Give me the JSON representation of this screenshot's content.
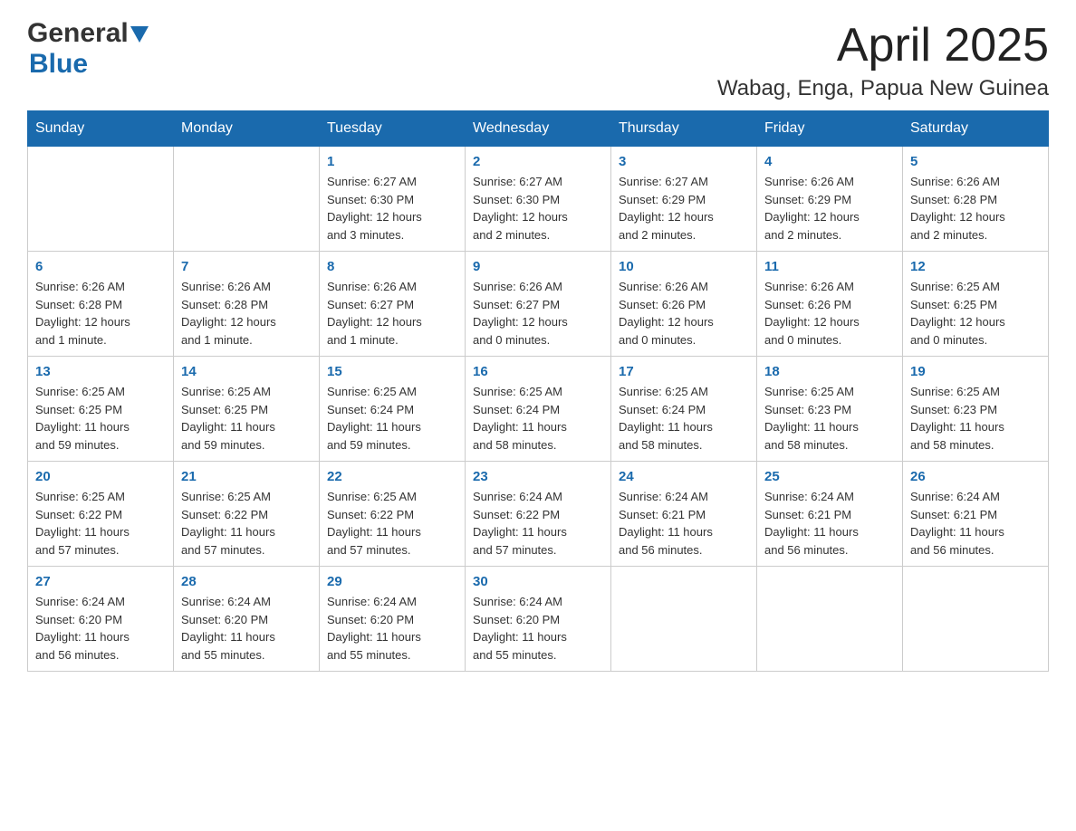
{
  "header": {
    "logo": {
      "general": "General",
      "blue": "Blue",
      "triangle": "▶"
    },
    "title": "April 2025",
    "subtitle": "Wabag, Enga, Papua New Guinea"
  },
  "calendar": {
    "days_of_week": [
      "Sunday",
      "Monday",
      "Tuesday",
      "Wednesday",
      "Thursday",
      "Friday",
      "Saturday"
    ],
    "weeks": [
      [
        {
          "day": "",
          "info": ""
        },
        {
          "day": "",
          "info": ""
        },
        {
          "day": "1",
          "info": "Sunrise: 6:27 AM\nSunset: 6:30 PM\nDaylight: 12 hours\nand 3 minutes."
        },
        {
          "day": "2",
          "info": "Sunrise: 6:27 AM\nSunset: 6:30 PM\nDaylight: 12 hours\nand 2 minutes."
        },
        {
          "day": "3",
          "info": "Sunrise: 6:27 AM\nSunset: 6:29 PM\nDaylight: 12 hours\nand 2 minutes."
        },
        {
          "day": "4",
          "info": "Sunrise: 6:26 AM\nSunset: 6:29 PM\nDaylight: 12 hours\nand 2 minutes."
        },
        {
          "day": "5",
          "info": "Sunrise: 6:26 AM\nSunset: 6:28 PM\nDaylight: 12 hours\nand 2 minutes."
        }
      ],
      [
        {
          "day": "6",
          "info": "Sunrise: 6:26 AM\nSunset: 6:28 PM\nDaylight: 12 hours\nand 1 minute."
        },
        {
          "day": "7",
          "info": "Sunrise: 6:26 AM\nSunset: 6:28 PM\nDaylight: 12 hours\nand 1 minute."
        },
        {
          "day": "8",
          "info": "Sunrise: 6:26 AM\nSunset: 6:27 PM\nDaylight: 12 hours\nand 1 minute."
        },
        {
          "day": "9",
          "info": "Sunrise: 6:26 AM\nSunset: 6:27 PM\nDaylight: 12 hours\nand 0 minutes."
        },
        {
          "day": "10",
          "info": "Sunrise: 6:26 AM\nSunset: 6:26 PM\nDaylight: 12 hours\nand 0 minutes."
        },
        {
          "day": "11",
          "info": "Sunrise: 6:26 AM\nSunset: 6:26 PM\nDaylight: 12 hours\nand 0 minutes."
        },
        {
          "day": "12",
          "info": "Sunrise: 6:25 AM\nSunset: 6:25 PM\nDaylight: 12 hours\nand 0 minutes."
        }
      ],
      [
        {
          "day": "13",
          "info": "Sunrise: 6:25 AM\nSunset: 6:25 PM\nDaylight: 11 hours\nand 59 minutes."
        },
        {
          "day": "14",
          "info": "Sunrise: 6:25 AM\nSunset: 6:25 PM\nDaylight: 11 hours\nand 59 minutes."
        },
        {
          "day": "15",
          "info": "Sunrise: 6:25 AM\nSunset: 6:24 PM\nDaylight: 11 hours\nand 59 minutes."
        },
        {
          "day": "16",
          "info": "Sunrise: 6:25 AM\nSunset: 6:24 PM\nDaylight: 11 hours\nand 58 minutes."
        },
        {
          "day": "17",
          "info": "Sunrise: 6:25 AM\nSunset: 6:24 PM\nDaylight: 11 hours\nand 58 minutes."
        },
        {
          "day": "18",
          "info": "Sunrise: 6:25 AM\nSunset: 6:23 PM\nDaylight: 11 hours\nand 58 minutes."
        },
        {
          "day": "19",
          "info": "Sunrise: 6:25 AM\nSunset: 6:23 PM\nDaylight: 11 hours\nand 58 minutes."
        }
      ],
      [
        {
          "day": "20",
          "info": "Sunrise: 6:25 AM\nSunset: 6:22 PM\nDaylight: 11 hours\nand 57 minutes."
        },
        {
          "day": "21",
          "info": "Sunrise: 6:25 AM\nSunset: 6:22 PM\nDaylight: 11 hours\nand 57 minutes."
        },
        {
          "day": "22",
          "info": "Sunrise: 6:25 AM\nSunset: 6:22 PM\nDaylight: 11 hours\nand 57 minutes."
        },
        {
          "day": "23",
          "info": "Sunrise: 6:24 AM\nSunset: 6:22 PM\nDaylight: 11 hours\nand 57 minutes."
        },
        {
          "day": "24",
          "info": "Sunrise: 6:24 AM\nSunset: 6:21 PM\nDaylight: 11 hours\nand 56 minutes."
        },
        {
          "day": "25",
          "info": "Sunrise: 6:24 AM\nSunset: 6:21 PM\nDaylight: 11 hours\nand 56 minutes."
        },
        {
          "day": "26",
          "info": "Sunrise: 6:24 AM\nSunset: 6:21 PM\nDaylight: 11 hours\nand 56 minutes."
        }
      ],
      [
        {
          "day": "27",
          "info": "Sunrise: 6:24 AM\nSunset: 6:20 PM\nDaylight: 11 hours\nand 56 minutes."
        },
        {
          "day": "28",
          "info": "Sunrise: 6:24 AM\nSunset: 6:20 PM\nDaylight: 11 hours\nand 55 minutes."
        },
        {
          "day": "29",
          "info": "Sunrise: 6:24 AM\nSunset: 6:20 PM\nDaylight: 11 hours\nand 55 minutes."
        },
        {
          "day": "30",
          "info": "Sunrise: 6:24 AM\nSunset: 6:20 PM\nDaylight: 11 hours\nand 55 minutes."
        },
        {
          "day": "",
          "info": ""
        },
        {
          "day": "",
          "info": ""
        },
        {
          "day": "",
          "info": ""
        }
      ]
    ]
  }
}
